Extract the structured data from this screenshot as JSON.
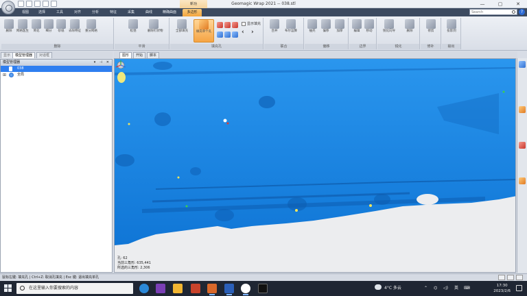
{
  "window": {
    "title": "Geomagic Wrap 2021 -- 038.stl",
    "context_group": "新功",
    "controls": [
      "—",
      "▢",
      "✕"
    ]
  },
  "ribbon_tabs": [
    {
      "label": "视图"
    },
    {
      "label": "选择"
    },
    {
      "label": "工具"
    },
    {
      "label": "对齐"
    },
    {
      "label": "分析"
    },
    {
      "label": "特征"
    },
    {
      "label": "采集"
    },
    {
      "label": "曲线"
    },
    {
      "label": "精确曲面"
    },
    {
      "label": "多边形"
    }
  ],
  "search": {
    "placeholder": "Search"
  },
  "ribbon": {
    "groups": [
      {
        "label": "删除"
      },
      {
        "label": "平滑"
      },
      {
        "label": "填充孔"
      },
      {
        "label": "联合"
      },
      {
        "label": "偏移"
      },
      {
        "label": "边界"
      },
      {
        "label": "锐化"
      },
      {
        "label": "修补"
      },
      {
        "label": "输出"
      }
    ],
    "buttons": {
      "delete": "删除",
      "mesh_doctor": "网格医生",
      "simplify": "简化",
      "refine": "细分",
      "sand": "砂纸",
      "remove_feature": "去除特征",
      "reduce_noise": "重分网格",
      "relax": "松弛",
      "remove_spikes": "删除钉状物",
      "fill_all": "全部填充",
      "fill_single": "填充单个孔",
      "show_fill": "显示填充",
      "merge": "合并",
      "boolean": "布尔运算",
      "extrude": "抽壳",
      "offset": "偏移",
      "thicken": "加厚",
      "edit_boundary": "编辑",
      "boundary2": "移动",
      "sharpen": "锐化向导",
      "repair": "删除",
      "trim": "修剪",
      "project": "投影",
      "export": "投影到"
    }
  },
  "panel_tabs": [
    {
      "label": "显示"
    },
    {
      "label": "模型管理器"
    },
    {
      "label": "对话框"
    }
  ],
  "model_manager": {
    "title": "模型管理器",
    "items": [
      {
        "label": "038"
      },
      {
        "label": "全局"
      }
    ]
  },
  "view_tabs": [
    {
      "label": "图形"
    },
    {
      "label": "开始"
    },
    {
      "label": "脚本"
    }
  ],
  "readout": {
    "holes": "孔: 62",
    "triangles": "当前三角形: 635,441",
    "selected_triangles": "所选的三角形: 2,306"
  },
  "statusbar": {
    "hint": "鼠标左键: 填充孔 | Ctrl+Z: 取消孔填充 | Esc 键: 退出填充单孔"
  },
  "taskbar": {
    "search_placeholder": "在这里输入你要搜索的内容",
    "weather": "4°C  多云",
    "ime": "英",
    "time": "17:30",
    "date": "2023/2/6"
  },
  "colors": {
    "mesh": "#1f8ee8",
    "mesh_dark": "#0f62b8",
    "selection": "#2f7ff0",
    "accent": "#f5a444"
  }
}
